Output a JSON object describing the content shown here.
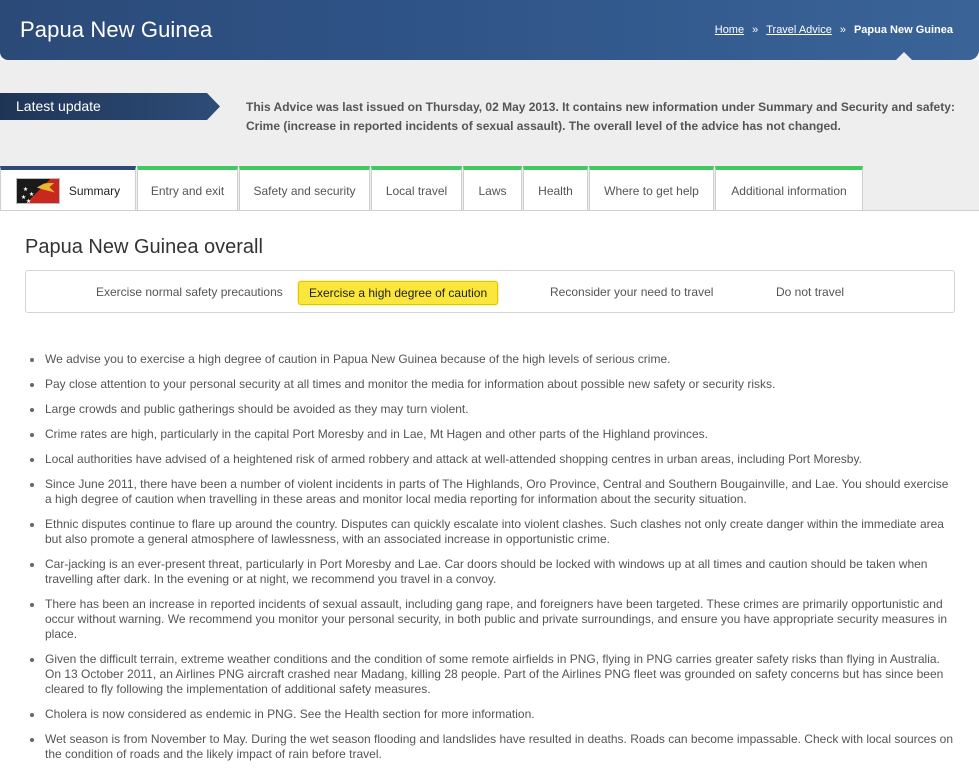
{
  "header": {
    "title": "Papua New Guinea",
    "breadcrumb": {
      "home": "Home",
      "sep1": "»",
      "travel_advice": "Travel Advice",
      "sep2": "»",
      "current": "Papua New Guinea"
    }
  },
  "latest_update": {
    "label": "Latest update",
    "text": "This Advice was last issued on Thursday, 02 May 2013.   It contains new information under Summary and Security and safety: Crime (increase in reported incidents of sexual assault). The overall level of the advice has not changed."
  },
  "tabs": [
    {
      "label": "Summary",
      "active": true,
      "icon": "png-flag-icon"
    },
    {
      "label": "Entry and exit"
    },
    {
      "label": "Safety and security"
    },
    {
      "label": "Local travel"
    },
    {
      "label": "Laws"
    },
    {
      "label": "Health"
    },
    {
      "label": "Where to get help"
    },
    {
      "label": "Additional information"
    }
  ],
  "overall": {
    "title": "Papua New Guinea overall",
    "levels": [
      {
        "label": "Exercise normal safety precautions"
      },
      {
        "label": "Exercise a high degree of caution",
        "selected": true
      },
      {
        "label": "Reconsider your need to travel"
      },
      {
        "label": "Do not travel"
      }
    ]
  },
  "bullets": [
    "We advise you to exercise a high degree of caution in Papua New Guinea because of the high levels of serious crime.",
    "Pay close attention to your personal security at all times and monitor the media for information about possible new safety or security risks.",
    "Large crowds and public gatherings should be avoided as they may turn violent.",
    "Crime rates are high, particularly in the capital Port Moresby and in Lae, Mt Hagen and other parts of the Highland provinces.",
    "Local authorities have advised of a heightened risk of armed robbery and attack at well-attended shopping centres in urban areas, including Port Moresby.",
    "Since June 2011, there have been a number of violent incidents in parts of The Highlands, Oro Province, Central and Southern Bougainville, and Lae. You should exercise a high degree of caution when travelling in these areas and monitor local media reporting for information about the security situation.",
    "Ethnic disputes continue to flare up around the country. Disputes can quickly escalate into violent clashes. Such clashes not only create danger within the immediate area but also promote a general atmosphere of lawlessness, with an associated increase in opportunistic crime.",
    "Car-jacking is an ever-present threat, particularly in Port Moresby and Lae. Car doors should be locked with windows up at all times and caution should be taken when travelling after dark. In the evening or at night, we recommend you travel in a convoy.",
    "There has been an increase in reported incidents of sexual assault, including gang rape, and foreigners have been targeted. These crimes are primarily opportunistic and occur without warning. We recommend you monitor your personal security, in both public and private surroundings, and ensure you have appropriate security measures in place.",
    "Given the difficult terrain, extreme weather conditions and the condition of some remote airfields in PNG, flying in PNG carries greater safety risks than flying in Australia. On 13 October 2011, an Airlines PNG aircraft crashed near Madang, killing 28 people. Part of the Airlines PNG fleet was grounded on safety concerns but has since been cleared to fly following the implementation of additional safety measures.",
    "Cholera is now considered as endemic in PNG. See the Health section for more information.",
    "Wet season is from November to May. During the wet season flooding and landslides have resulted in deaths. Roads can become impassable. Check with local sources on the condition of roads and the likely impact of rain before travel."
  ],
  "colors": {
    "header_blue": "#2f5488",
    "tab_green": "#3fca5e",
    "active_tab": "#2d4a78",
    "highlight_yellow": "#fbe63c"
  }
}
